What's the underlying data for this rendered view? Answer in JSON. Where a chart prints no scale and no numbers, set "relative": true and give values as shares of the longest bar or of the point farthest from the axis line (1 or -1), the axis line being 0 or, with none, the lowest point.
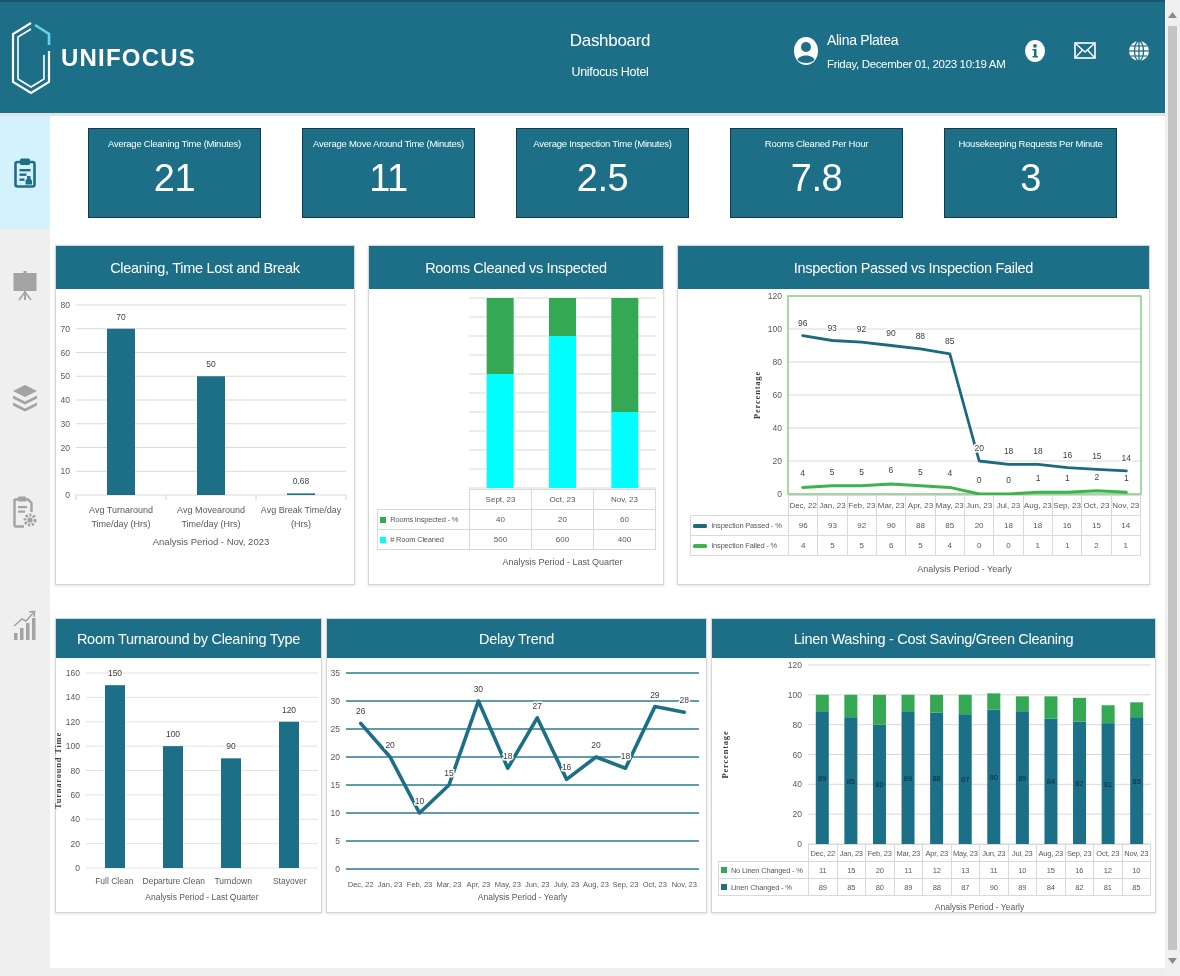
{
  "header": {
    "brand": "UNIFOCUS",
    "title": "Dashboard",
    "subtitle": "Unifocus Hotel",
    "user": {
      "name": "Alina Platea",
      "datetime": "Friday, December 01, 2023 10:19 AM"
    }
  },
  "sidebar": {
    "items": [
      {
        "selected": true
      },
      {
        "selected": false
      },
      {
        "selected": false
      },
      {
        "selected": false
      },
      {
        "selected": false
      }
    ]
  },
  "kpis": [
    {
      "label": "Average Cleaning Time (Minutes)",
      "value": "21"
    },
    {
      "label": "Average Move Around Time (Minutes)",
      "value": "11"
    },
    {
      "label": "Average Inspection Time (Minutes)",
      "value": "2.5"
    },
    {
      "label": "Rooms Cleaned Per Hour",
      "value": "7.8"
    },
    {
      "label": "Housekeeping Requests Per Minute",
      "value": "3"
    }
  ],
  "panels": [
    {
      "title": "Cleaning, Time Lost and Break",
      "chart_data": {
        "type": "bar",
        "categories": [
          "Avg Turnaround Time/day (Hrs)",
          "Avg Movearound Time/day (Hrs)",
          "Avg Break Time/day (Hrs)"
        ],
        "values": [
          70,
          50,
          0.68
        ],
        "value_labels": [
          "70",
          "50",
          "0.68"
        ],
        "xlabel": "Analysis Period - Nov, 2023",
        "ylim": [
          0,
          80
        ],
        "yticks": [
          {
            "value": 0,
            "label": "0"
          },
          {
            "value": 10,
            "label": "10"
          },
          {
            "value": 20,
            "label": "20"
          },
          {
            "value": 30,
            "label": "30"
          },
          {
            "value": 40,
            "label": "40"
          },
          {
            "value": 50,
            "label": "50"
          },
          {
            "value": 60,
            "label": "60"
          },
          {
            "value": 70,
            "label": "70"
          },
          {
            "value": 80,
            "label": "80"
          }
        ],
        "grid": true
      }
    },
    {
      "title": "Rooms Cleaned vs Inspected",
      "chart_data": {
        "type": "bar",
        "stacked": true,
        "relative": true,
        "categories": [
          "Sept, 23",
          "Oct, 23",
          "Nov, 23"
        ],
        "series": [
          {
            "name": "Rooms Inspected - %",
            "color": "#34a853",
            "values": [
              0.4,
              0.2,
              0.6
            ]
          },
          {
            "name": "# Room Cleaned",
            "color": "#00ffff",
            "values": [
              0.6,
              0.8,
              0.4
            ]
          }
        ],
        "xlabel": "Analysis Period - Last Quarter",
        "grid": true,
        "legend": true
      },
      "data_table": {
        "rows": [
          {
            "values": [
              "40",
              "20",
              "60"
            ]
          },
          {
            "values": [
              "500",
              "600",
              "400"
            ]
          }
        ]
      }
    },
    {
      "title": "Inspection Passed vs Inspection Failed",
      "chart_data": {
        "type": "line",
        "x": [
          "Dec, 22",
          "Jan, 23",
          "Feb, 23",
          "Mar, 23",
          "Apr, 23",
          "May, 23",
          "Jun, 23",
          "Jul, 23",
          "Aug, 23",
          "Sep, 23",
          "Oct, 23",
          "Nov, 23"
        ],
        "series": [
          {
            "name": "Inspection Passed - %",
            "color": "#1b6a80",
            "values": [
              96,
              93,
              92,
              90,
              88,
              85,
              20,
              18,
              18,
              16,
              15,
              14
            ],
            "value_labels": [
              "96",
              "93",
              "92",
              "90",
              "88",
              "85",
              "20",
              "18",
              "18",
              "16",
              "15",
              "14"
            ]
          },
          {
            "name": "Inspection Failed - %",
            "color": "#3cb44b",
            "values": [
              4,
              5,
              5,
              6,
              5,
              4,
              0,
              0,
              1,
              1,
              2,
              1
            ],
            "value_labels": [
              "4",
              "5",
              "5",
              "6",
              "5",
              "4",
              "0",
              "0",
              "1",
              "1",
              "2",
              "1"
            ]
          }
        ],
        "ylabel": "Percentage",
        "xlabel": "Analysis Period - Yearly",
        "ylim": [
          0,
          120
        ],
        "yticks": [
          {
            "value": 0,
            "label": "0"
          },
          {
            "value": 20,
            "label": "20"
          },
          {
            "value": 40,
            "label": "40"
          },
          {
            "value": 60,
            "label": "60"
          },
          {
            "value": 80,
            "label": "80"
          },
          {
            "value": 100,
            "label": "100"
          },
          {
            "value": 120,
            "label": "120"
          }
        ],
        "grid": true,
        "legend": true
      },
      "data_table": {
        "rows": [
          {
            "values": [
              "96",
              "93",
              "92",
              "90",
              "88",
              "85",
              "20",
              "18",
              "18",
              "16",
              "15",
              "14"
            ]
          },
          {
            "values": [
              "4",
              "5",
              "5",
              "6",
              "5",
              "4",
              "0",
              "0",
              "1",
              "1",
              "2",
              "1"
            ]
          }
        ]
      }
    },
    {
      "title": "Room Turnaround by Cleaning Type",
      "chart_data": {
        "type": "bar",
        "categories": [
          "Full Clean",
          "Departure Clean",
          "Turndown",
          "Stayover"
        ],
        "values": [
          150,
          100,
          90,
          120
        ],
        "value_labels": [
          "150",
          "100",
          "90",
          "120"
        ],
        "ylabel": "Turnaround Time",
        "xlabel": "Analysis Period - Last Quarter",
        "ylim": [
          0,
          160
        ],
        "yticks": [
          {
            "value": 0,
            "label": "0"
          },
          {
            "value": 20,
            "label": "20"
          },
          {
            "value": 40,
            "label": "40"
          },
          {
            "value": 60,
            "label": "60"
          },
          {
            "value": 80,
            "label": "80"
          },
          {
            "value": 100,
            "label": "100"
          },
          {
            "value": 120,
            "label": "120"
          },
          {
            "value": 140,
            "label": "140"
          },
          {
            "value": 160,
            "label": "160"
          }
        ],
        "grid": true
      }
    },
    {
      "title": "Delay Trend",
      "chart_data": {
        "type": "line",
        "x": [
          "Dec, 22",
          "Jan, 23",
          "Feb, 23",
          "Mar, 23",
          "Apr, 23",
          "May, 23",
          "Jun, 23",
          "July, 23",
          "Aug, 23",
          "Sep, 23",
          "Oct, 23",
          "Nov, 23"
        ],
        "values": [
          26,
          20,
          10,
          15,
          30,
          18,
          27,
          16,
          20,
          18,
          29,
          28
        ],
        "value_labels": [
          "26",
          "20",
          "10",
          "15",
          "30",
          "18",
          "27",
          "16",
          "20",
          "18",
          "29",
          "28"
        ],
        "xlabel": "Analysis Period - Yearly",
        "ylim": [
          0,
          35
        ],
        "yticks": [
          {
            "value": 0,
            "label": "0"
          },
          {
            "value": 5,
            "label": "5"
          },
          {
            "value": 10,
            "label": "10"
          },
          {
            "value": 15,
            "label": "15"
          },
          {
            "value": 20,
            "label": "20"
          },
          {
            "value": 25,
            "label": "25"
          },
          {
            "value": 30,
            "label": "30"
          },
          {
            "value": 35,
            "label": "35"
          }
        ],
        "grid": true
      }
    },
    {
      "title": "Linen Washing - Cost Saving/Green Cleaning",
      "chart_data": {
        "type": "bar",
        "stacked": true,
        "categories": [
          "Dec, 22",
          "Jan, 23",
          "Feb, 23",
          "Mar, 23",
          "Apr, 23",
          "May, 23",
          "Jun, 23",
          "Jul, 23",
          "Aug, 23",
          "Sep, 23",
          "Oct, 23",
          "Nov, 23"
        ],
        "series": [
          {
            "name": "No Linen Changed - %",
            "color": "#34a853",
            "values": [
              11,
              15,
              20,
              11,
              12,
              13,
              11,
              10,
              15,
              16,
              12,
              10
            ]
          },
          {
            "name": "Linen Changed - %",
            "color": "#1b6f87",
            "values": [
              89,
              85,
              80,
              89,
              88,
              87,
              90,
              89,
              84,
              82,
              81,
              85
            ],
            "value_labels": [
              "89",
              "85",
              "80",
              "89",
              "88",
              "87",
              "90",
              "89",
              "84",
              "82",
              "81",
              "85"
            ]
          }
        ],
        "ylabel": "Percentage",
        "xlabel": "Analysis Period - Yearly",
        "ylim": [
          0,
          120
        ],
        "yticks": [
          {
            "value": 0,
            "label": "0"
          },
          {
            "value": 20,
            "label": "20"
          },
          {
            "value": 40,
            "label": "40"
          },
          {
            "value": 60,
            "label": "60"
          },
          {
            "value": 80,
            "label": "80"
          },
          {
            "value": 100,
            "label": "100"
          },
          {
            "value": 120,
            "label": "120"
          }
        ],
        "grid": true,
        "legend": true
      },
      "data_table": {
        "rows": [
          {
            "values": [
              "11",
              "15",
              "20",
              "11",
              "12",
              "13",
              "11",
              "10",
              "15",
              "16",
              "12",
              "10"
            ]
          },
          {
            "values": [
              "89",
              "85",
              "80",
              "89",
              "88",
              "87",
              "90",
              "89",
              "84",
              "82",
              "81",
              "85"
            ]
          }
        ]
      }
    }
  ]
}
